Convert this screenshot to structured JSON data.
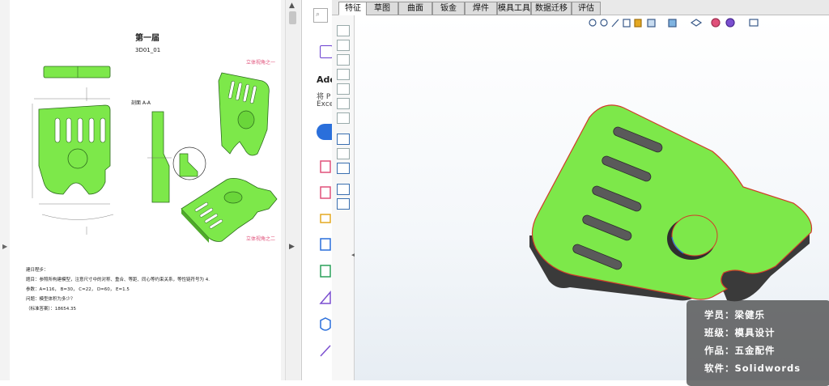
{
  "pdf": {
    "title": "第一届",
    "part_no": "3D01_01",
    "section_label": "剖面 A-A",
    "view_label_1": "立体视角之一",
    "view_label_2": "立体视角之二",
    "notes": [
      "建日程步：",
      "题目：参照所构建模型，注意尺寸中的对称、重合、等距、同心等约束关系，等性链符号为 4.",
      "参数：A=116， B=30， C=22， D=60， E=1.5",
      "问题：模型体积为多少？",
      "（标准答案）：18654.35"
    ]
  },
  "adobe": {
    "heading_partial": "Ado",
    "line1_partial": "将 P",
    "line2_partial": "Exce"
  },
  "solidworks": {
    "tabs": [
      "特征",
      "草图",
      "曲面",
      "钣金",
      "焊件",
      "模具工具",
      "数据迁移",
      "评估"
    ],
    "active_tab": "特征"
  },
  "info": {
    "student": "学员：梁健乐",
    "class": "班级：模具设计",
    "work": "作品：五金配件",
    "software": "软件：Solidwords"
  },
  "colors": {
    "part_green": "#7de84a",
    "edge_red": "#d23a2a",
    "pink_label": "#e0507a",
    "accent_blue": "#2a6fdb",
    "adobe_purple": "#7b4fd0"
  }
}
